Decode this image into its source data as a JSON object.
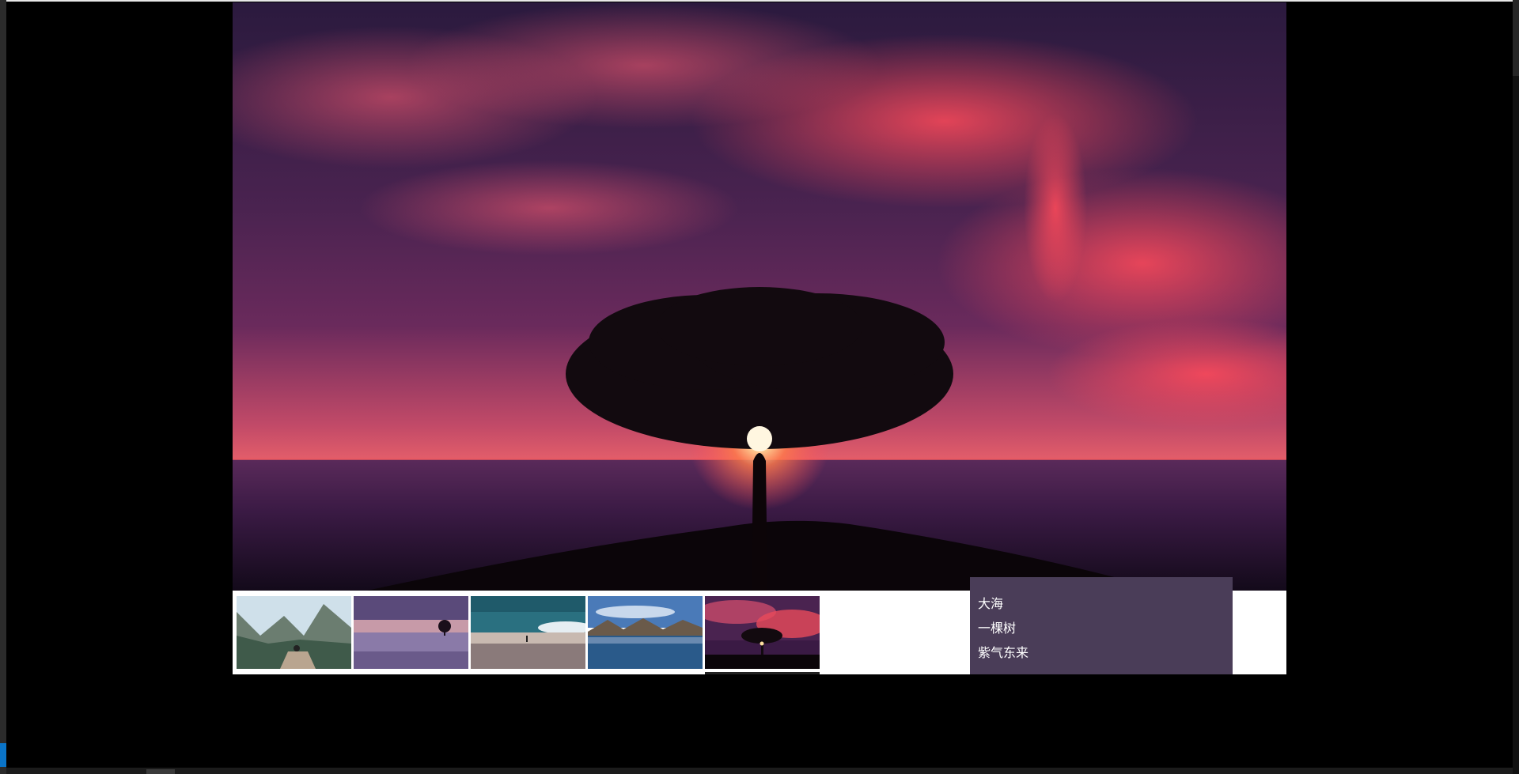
{
  "slider": {
    "main_image_alt": "一棵树",
    "thumbnails": [
      {
        "name": "thumbnail-mountain-lake"
      },
      {
        "name": "thumbnail-lone-tree"
      },
      {
        "name": "thumbnail-beach"
      },
      {
        "name": "thumbnail-mountain-reflection"
      },
      {
        "name": "thumbnail-tree-sunset",
        "active": true
      }
    ],
    "captions": [
      "大海",
      "一棵树",
      "紫气东来"
    ]
  },
  "colors": {
    "caption_bg": "#4a3d58",
    "caption_text": "#ffffff",
    "page_bg": "#000000",
    "thumb_strip_bg": "#ffffff",
    "accent": "#0a74c8"
  }
}
